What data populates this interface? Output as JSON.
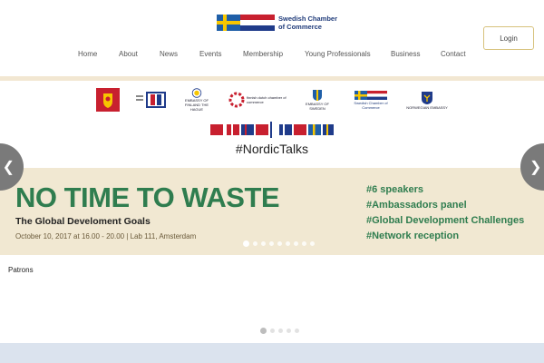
{
  "header": {
    "logo_line1": "Swedish Chamber",
    "logo_line2": "of Commerce",
    "login_label": "Login"
  },
  "nav": {
    "items": [
      "Home",
      "About",
      "News",
      "Events",
      "Membership",
      "Young Professionals",
      "Business",
      "Contact"
    ]
  },
  "sponsors": {
    "items": [
      {
        "icon": "coat-of-arms-icon",
        "label": ""
      },
      {
        "icon": "embassy-logo-icon",
        "label": ""
      },
      {
        "icon": "finland-embassy-icon",
        "label": "EMBASSY OF FINLAND THE HAGUE"
      },
      {
        "icon": "finnish-dutch-chamber-icon",
        "label": "finnish dutch chamber of commerce"
      },
      {
        "icon": "sweden-embassy-icon",
        "label": "EMBASSY OF SWEDEN"
      },
      {
        "icon": "swedish-chamber-icon",
        "label": "Swedish Chamber of Commerce"
      },
      {
        "icon": "norwegian-embassy-icon",
        "label": "NORWEGIAN EMBASSY"
      }
    ]
  },
  "promo": {
    "hashtag": "#NordicTalks",
    "headline": "NO TIME TO WASTE",
    "subtitle": "The Global Develoment Goals",
    "details": "October 10, 2017  at 16.00 - 20.00  |  Lab 111, Amsterdam",
    "tags": [
      "#6 speakers",
      "#Ambassadors panel",
      "#Global Development Challenges",
      "#Network reception"
    ]
  },
  "carousel": {
    "prev_icon": "chevron-left-icon",
    "next_icon": "chevron-right-icon",
    "slide_count": 9,
    "active_slide": 1
  },
  "patrons": {
    "title": "Patrons",
    "slide_count": 5,
    "active_slide": 1
  },
  "colors": {
    "accent_green": "#2f7d4f",
    "banner_bg": "#f1e8d2",
    "swedish_blue": "#1f5fa8",
    "swedish_yellow": "#f7c600"
  }
}
